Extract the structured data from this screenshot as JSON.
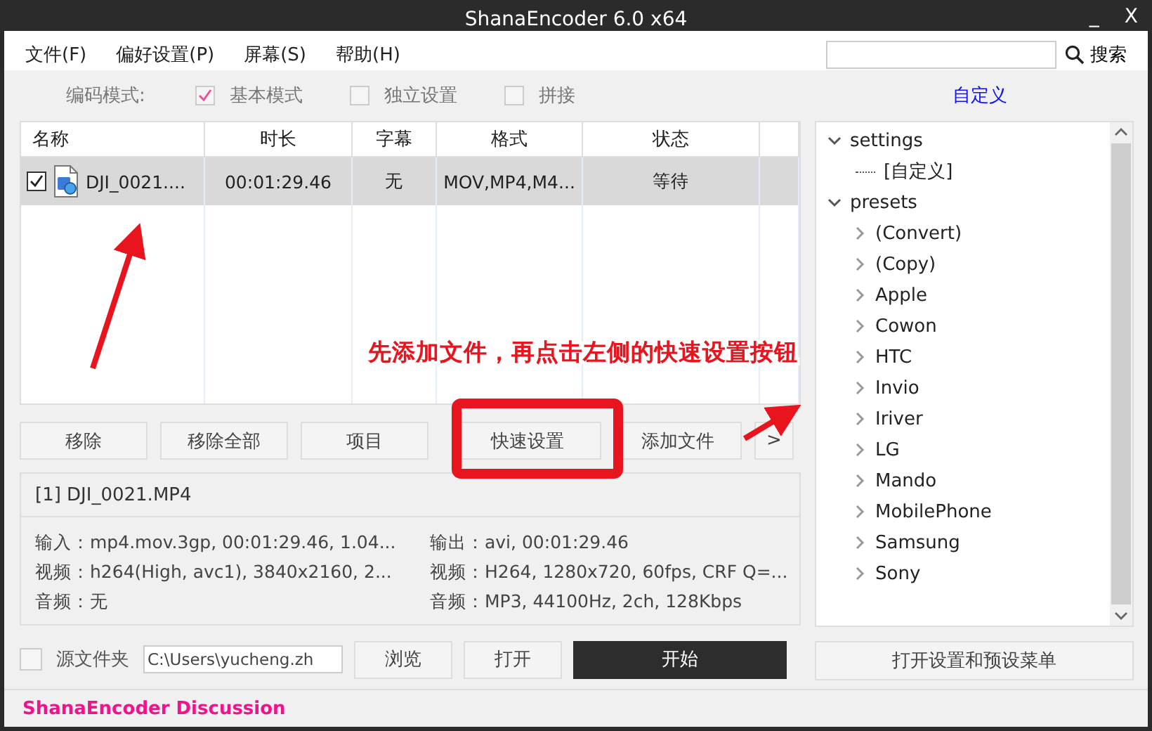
{
  "window": {
    "title": "ShanaEncoder 6.0 x64",
    "controls": [
      "_",
      "X"
    ]
  },
  "menu": [
    "文件(F)",
    "偏好设置(P)",
    "屏幕(S)",
    "帮助(H)"
  ],
  "search": {
    "button": "搜索"
  },
  "mode": {
    "label": "编码模式:",
    "options": [
      {
        "label": "基本模式",
        "checked": true
      },
      {
        "label": "独立设置",
        "checked": false
      },
      {
        "label": "拼接",
        "checked": false
      }
    ],
    "link": "自定义"
  },
  "table": {
    "columns": [
      "名称",
      "时长",
      "字幕",
      "格式",
      "状态"
    ],
    "rows": [
      {
        "checked": true,
        "selected": true,
        "cells": [
          "DJI_0021....",
          "00:01:29.46",
          "无",
          "MOV,MP4,M4...",
          "等待"
        ]
      }
    ]
  },
  "buttons": [
    {
      "label": "移除"
    },
    {
      "label": "移除全部"
    },
    {
      "label": "项目"
    },
    {
      "label": "快速设置"
    },
    {
      "label": "添加文件"
    },
    {
      "label": ">"
    }
  ],
  "info": {
    "title": "[1] DJI_0021.MP4",
    "left": [
      "输入：mp4.mov.3gp, 00:01:29.46, 1.04...",
      "视频：h264(High, avc1), 3840x2160, 2...",
      "音频：无"
    ],
    "right": [
      "输出：avi, 00:01:29.46",
      "视频：H264, 1280x720, 60fps, CRF Q=...",
      "音频：MP3, 44100Hz, 2ch, 128Kbps"
    ]
  },
  "bottom": {
    "source_folder": {
      "label": "源文件夹",
      "checked": false
    },
    "path": "C:\\Users\\yucheng.zh",
    "buttons": [
      "浏览",
      "打开"
    ],
    "start": "开始"
  },
  "tree": [
    {
      "label": "settings",
      "expanded": true,
      "children": [
        {
          "label": "[自定义]"
        }
      ]
    },
    {
      "label": "presets",
      "expanded": true,
      "children": [
        {
          "label": "(Convert)",
          "expanded": false
        },
        {
          "label": "(Copy)",
          "expanded": false
        },
        {
          "label": "Apple",
          "expanded": false
        },
        {
          "label": "Cowon",
          "expanded": false
        },
        {
          "label": "HTC",
          "expanded": false
        },
        {
          "label": "Invio",
          "expanded": false
        },
        {
          "label": "Iriver",
          "expanded": false
        },
        {
          "label": "LG",
          "expanded": false
        },
        {
          "label": "Mando",
          "expanded": false
        },
        {
          "label": "MobilePhone",
          "expanded": false
        },
        {
          "label": "Samsung",
          "expanded": false
        },
        {
          "label": "Sony",
          "expanded": false
        }
      ]
    }
  ],
  "tree_button": "打开设置和预设菜单",
  "footer": "ShanaEncoder Discussion",
  "annotation": {
    "text": "先添加文件，再点击左侧的快速设置按钮"
  }
}
